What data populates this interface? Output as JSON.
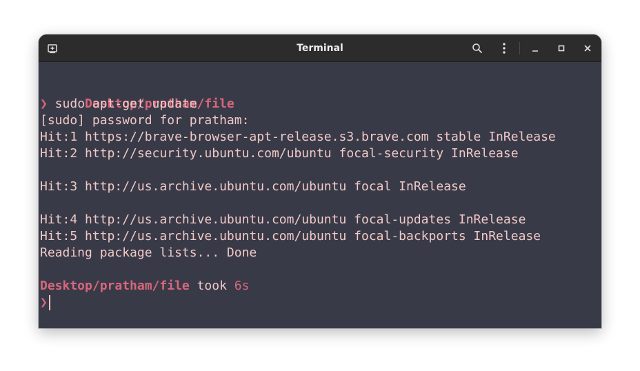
{
  "window": {
    "title": "Terminal"
  },
  "titlebar": {
    "new_tab_icon": "new-tab-icon",
    "search_icon": "search-icon",
    "menu_icon": "kebab-menu-icon",
    "minimize_icon": "minimize-icon",
    "maximize_icon": "maximize-icon",
    "close_icon": "close-icon"
  },
  "terminal": {
    "prompt1_path": "Desktop/pratham/file",
    "prompt_symbol": "❯",
    "command": " sudo apt-get update",
    "output": [
      "[sudo] password for pratham:",
      "Hit:1 https://brave-browser-apt-release.s3.brave.com stable InRelease",
      "Hit:2 http://security.ubuntu.com/ubuntu focal-security InRelease",
      "",
      "Hit:3 http://us.archive.ubuntu.com/ubuntu focal InRelease",
      "",
      "Hit:4 http://us.archive.ubuntu.com/ubuntu focal-updates InRelease",
      "Hit:5 http://us.archive.ubuntu.com/ubuntu focal-backports InRelease",
      "Reading package lists... Done"
    ],
    "prompt2_path": "Desktop/pratham/file",
    "took_label": " took ",
    "duration": "6s"
  },
  "colors": {
    "terminal_bg": "#383b47",
    "text": "#f2c8c8",
    "accent": "#d9667c",
    "titlebar_bg": "#2c2c2c"
  }
}
